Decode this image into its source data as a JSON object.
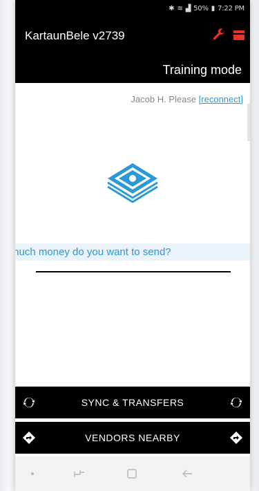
{
  "status_bar": {
    "icons": [
      "bluetooth-icon",
      "wifi-icon",
      "signal-icon",
      "battery-icon"
    ],
    "battery": "50%",
    "time": "7:22 PM"
  },
  "app_bar": {
    "title": "KartaunBele v2739",
    "mode": "Training mode",
    "accent_color": "#e8302c"
  },
  "content": {
    "user_text": "Jacob H. Please ",
    "reconnect_link": "[reconnect]",
    "question": "w much money do you want to send?",
    "accent_color": "#2b9ad4"
  },
  "bottom": {
    "sync_label": "SYNC & TRANSFERS",
    "vendors_label": "VENDORS NEARBY"
  }
}
